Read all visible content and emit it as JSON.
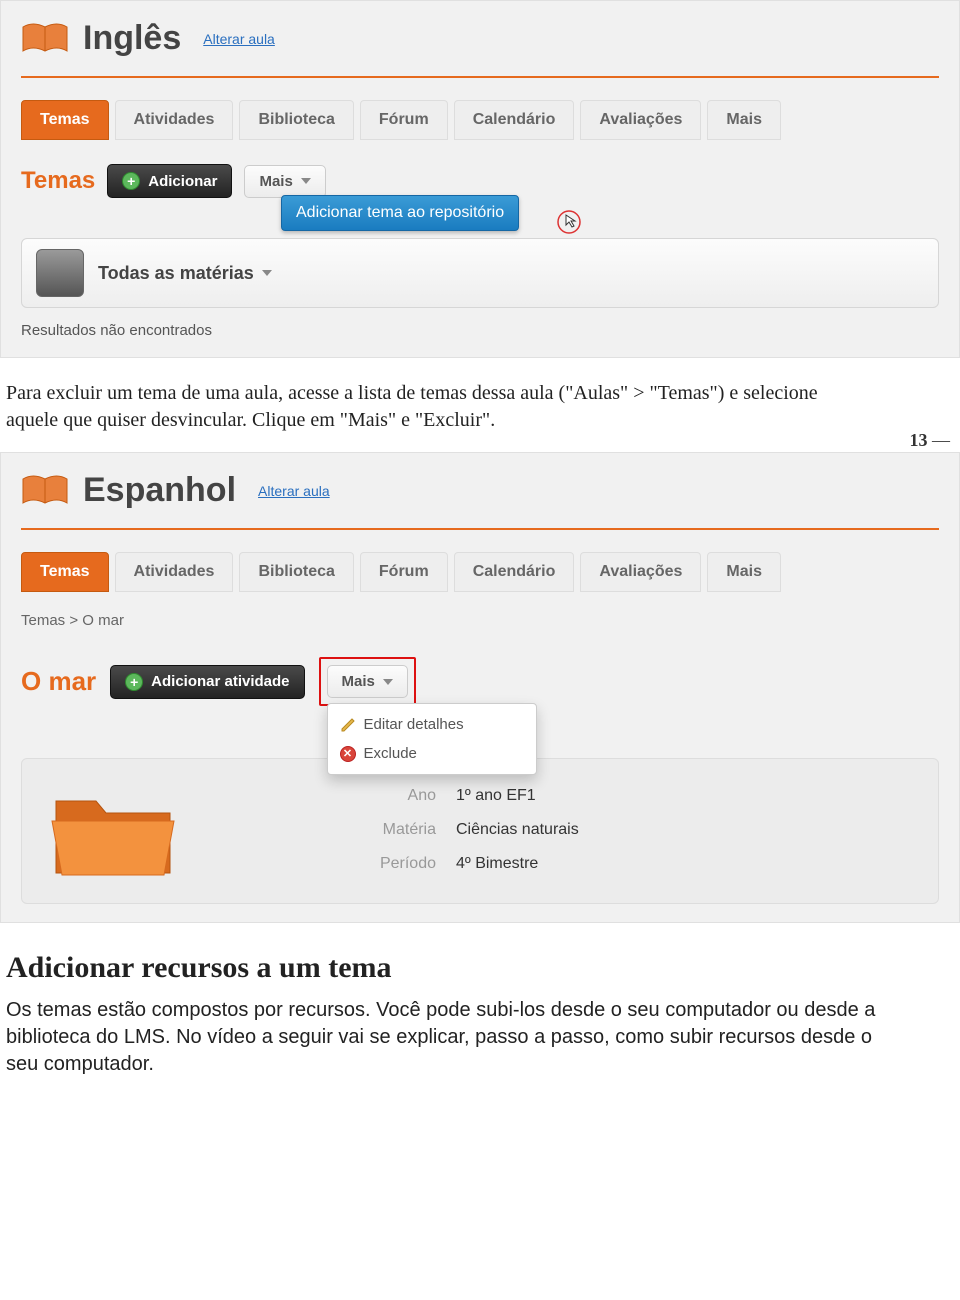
{
  "screenshot1": {
    "course_title": "Inglês",
    "change_link": "Alterar aula",
    "tabs": [
      "Temas",
      "Atividades",
      "Biblioteca",
      "Fórum",
      "Calendário",
      "Avaliações",
      "Mais"
    ],
    "section_title": "Temas",
    "add_btn": "Adicionar",
    "more_btn": "Mais",
    "tooltip": "Adicionar tema ao repositório",
    "subjects_label": "Todas as matérias",
    "results_text": "Resultados não encontrados"
  },
  "para1": "Para excluir um tema de uma aula, acesse a lista de temas dessa aula (\"Aulas\" > \"Temas\") e selecione aquele que quiser desvincular. Clique em \"Mais\" e \"Excluir\".",
  "page_number": "13",
  "screenshot2": {
    "course_title": "Espanhol",
    "change_link": "Alterar aula",
    "tabs": [
      "Temas",
      "Atividades",
      "Biblioteca",
      "Fórum",
      "Calendário",
      "Avaliações",
      "Mais"
    ],
    "breadcrumb_root": "Temas",
    "breadcrumb_sep": ">",
    "breadcrumb_cur": "O mar",
    "topic_title": "O mar",
    "add_activity_btn": "Adicionar atividade",
    "more_btn": "Mais",
    "dd_edit": "Editar detalhes",
    "dd_exclude": "Exclude",
    "details": {
      "ano_label": "Ano",
      "ano_val": "1º ano EF1",
      "materia_label": "Matéria",
      "materia_val": "Ciências naturais",
      "periodo_label": "Período",
      "periodo_val": "4º Bimestre"
    }
  },
  "heading2": "Adicionar recursos a um tema",
  "para2": "Os temas estão compostos por recursos. Você pode subi-los desde o seu computador ou desde a biblioteca do LMS. No vídeo a seguir vai se explicar, passo a passo, como subir recursos desde o seu computador."
}
